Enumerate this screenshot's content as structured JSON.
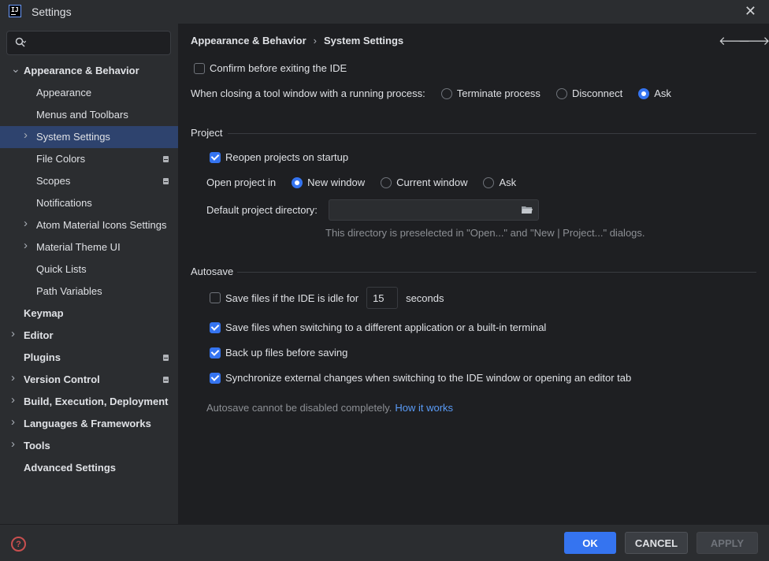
{
  "window": {
    "title": "Settings",
    "app_icon_text": "IJ"
  },
  "sidebar": {
    "search_placeholder": "",
    "items": [
      {
        "label": "Appearance & Behavior",
        "level": 0,
        "bold": true,
        "chevron": "down",
        "project": false
      },
      {
        "label": "Appearance",
        "level": 1,
        "bold": false,
        "chevron": "none",
        "project": false
      },
      {
        "label": "Menus and Toolbars",
        "level": 1,
        "bold": false,
        "chevron": "none",
        "project": false
      },
      {
        "label": "System Settings",
        "level": 1,
        "bold": false,
        "chevron": "right",
        "selected": true,
        "project": false
      },
      {
        "label": "File Colors",
        "level": 1,
        "bold": false,
        "chevron": "none",
        "project": true
      },
      {
        "label": "Scopes",
        "level": 1,
        "bold": false,
        "chevron": "none",
        "project": true
      },
      {
        "label": "Notifications",
        "level": 1,
        "bold": false,
        "chevron": "none",
        "project": false
      },
      {
        "label": "Atom Material Icons Settings",
        "level": 1,
        "bold": false,
        "chevron": "right",
        "project": false
      },
      {
        "label": "Material Theme UI",
        "level": 1,
        "bold": false,
        "chevron": "right",
        "project": false
      },
      {
        "label": "Quick Lists",
        "level": 1,
        "bold": false,
        "chevron": "none",
        "project": false
      },
      {
        "label": "Path Variables",
        "level": 1,
        "bold": false,
        "chevron": "none",
        "project": false
      },
      {
        "label": "Keymap",
        "level": 0,
        "bold": true,
        "chevron": "none",
        "project": false
      },
      {
        "label": "Editor",
        "level": 0,
        "bold": true,
        "chevron": "right",
        "project": false
      },
      {
        "label": "Plugins",
        "level": 0,
        "bold": true,
        "chevron": "none",
        "project": true
      },
      {
        "label": "Version Control",
        "level": 0,
        "bold": true,
        "chevron": "right",
        "project": true
      },
      {
        "label": "Build, Execution, Deployment",
        "level": 0,
        "bold": true,
        "chevron": "right",
        "project": false
      },
      {
        "label": "Languages & Frameworks",
        "level": 0,
        "bold": true,
        "chevron": "right",
        "project": false
      },
      {
        "label": "Tools",
        "level": 0,
        "bold": true,
        "chevron": "right",
        "project": false
      },
      {
        "label": "Advanced Settings",
        "level": 0,
        "bold": true,
        "chevron": "none",
        "project": false
      }
    ]
  },
  "breadcrumb": {
    "parent": "Appearance & Behavior",
    "separator": "›",
    "current": "System Settings"
  },
  "general": {
    "confirm_exit": {
      "label": "Confirm before exiting the IDE",
      "checked": false
    },
    "tool_window_label": "When closing a tool window with a running process:",
    "tool_window_options": [
      {
        "label": "Terminate process",
        "checked": false
      },
      {
        "label": "Disconnect",
        "checked": false
      },
      {
        "label": "Ask",
        "checked": true
      }
    ]
  },
  "project": {
    "title": "Project",
    "reopen": {
      "label": "Reopen projects on startup",
      "checked": true
    },
    "open_in_label": "Open project in",
    "open_in_options": [
      {
        "label": "New window",
        "checked": true
      },
      {
        "label": "Current window",
        "checked": false
      },
      {
        "label": "Ask",
        "checked": false
      }
    ],
    "default_dir_label": "Default project directory:",
    "default_dir_value": "",
    "default_dir_hint": "This directory is preselected in \"Open...\" and \"New | Project...\" dialogs."
  },
  "autosave": {
    "title": "Autosave",
    "idle": {
      "label": "Save files if the IDE is idle for",
      "checked": false,
      "value": "15",
      "suffix": "seconds"
    },
    "switching": {
      "label": "Save files when switching to a different application or a built-in terminal",
      "checked": true
    },
    "backup": {
      "label": "Back up files before saving",
      "checked": true
    },
    "sync": {
      "label": "Synchronize external changes when switching to the IDE window or opening an editor tab",
      "checked": true
    },
    "note": "Autosave cannot be disabled completely.",
    "note_link": "How it works"
  },
  "footer": {
    "ok": "OK",
    "cancel": "CANCEL",
    "apply": "APPLY",
    "help": "?"
  },
  "colors": {
    "accent": "#3574f0",
    "selection": "#2e436e",
    "link": "#5a9cf8",
    "background": "#1e1f22",
    "panel": "#2b2d30"
  },
  "icons": [
    "search-icon",
    "close-icon",
    "chevron-down-icon",
    "chevron-right-icon",
    "back-arrow-icon",
    "forward-arrow-icon",
    "folder-icon",
    "help-icon",
    "project-level-icon"
  ]
}
